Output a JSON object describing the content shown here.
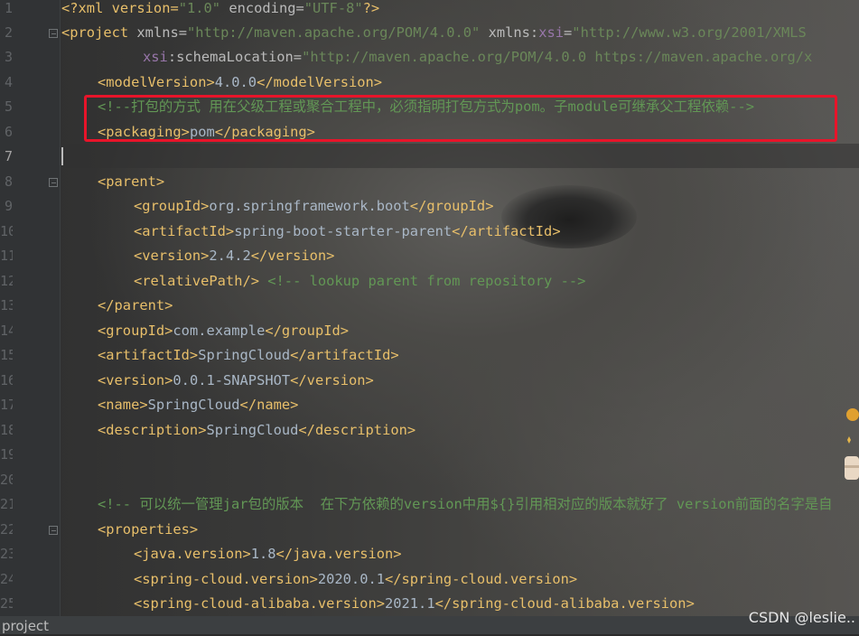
{
  "editor": {
    "line_numbers": [
      "1",
      "2",
      "3",
      "4",
      "5",
      "6",
      "7",
      "8",
      "9",
      "10",
      "11",
      "12",
      "13",
      "14",
      "15",
      "16",
      "17",
      "18",
      "19",
      "20",
      "21",
      "22",
      "23",
      "24",
      "25"
    ],
    "current_line": 7
  },
  "code": {
    "l1": {
      "a": "<?xml version=",
      "b": "\"1.0\"",
      "c": " encoding=",
      "d": "\"UTF-8\"",
      "e": "?>"
    },
    "l2": {
      "a": "<project ",
      "b": "xmlns=",
      "c": "\"http://maven.apache.org/POM/4.0.0\"",
      "d": " xmlns:",
      "e": "xsi",
      "f": "=",
      "g": "\"http://www.w3.org/2001/XMLS"
    },
    "l3": {
      "a": "xsi",
      "b": ":schemaLocation=",
      "c": "\"http://maven.apache.org/POM/4.0.0 https://maven.apache.org/x"
    },
    "l4": {
      "a": "<modelVersion>",
      "b": "4.0.0",
      "c": "</modelVersion>"
    },
    "l5": {
      "a": "<!--打包的方式 用在父级工程或聚合工程中，必须指明打包方式为pom。子module可继承父工程依赖-->"
    },
    "l6": {
      "a": "<packaging>",
      "b": "pom",
      "c": "</packaging>"
    },
    "l8": {
      "a": "<parent>"
    },
    "l9": {
      "a": "<groupId>",
      "b": "org.springframework.boot",
      "c": "</groupId>"
    },
    "l10": {
      "a": "<artifactId>",
      "b": "spring-boot-starter-parent",
      "c": "</artifactId>"
    },
    "l11": {
      "a": "<version>",
      "b": "2.4.2",
      "c": "</version>"
    },
    "l12": {
      "a": "<relativePath/>",
      "b": " <!-- lookup parent from repository -->"
    },
    "l13": {
      "a": "</parent>"
    },
    "l14": {
      "a": "<groupId>",
      "b": "com.example",
      "c": "</groupId>"
    },
    "l15": {
      "a": "<artifactId>",
      "b": "SpringCloud",
      "c": "</artifactId>"
    },
    "l16": {
      "a": "<version>",
      "b": "0.0.1-SNAPSHOT",
      "c": "</version>"
    },
    "l17": {
      "a": "<name>",
      "b": "SpringCloud",
      "c": "</name>"
    },
    "l18": {
      "a": "<description>",
      "b": "SpringCloud",
      "c": "</description>"
    },
    "l21": {
      "a": "<!-- 可以统一管理jar包的版本  在下方依赖的version中用${}引用相对应的版本就好了 version前面的名字是自"
    },
    "l22": {
      "a": "<properties>"
    },
    "l23": {
      "a": "<java.version>",
      "b": "1.8",
      "c": "</java.version>"
    },
    "l24": {
      "a": "<spring-cloud.version>",
      "b": "2020.0.1",
      "c": "</spring-cloud.version>"
    },
    "l25": {
      "a": "<spring-cloud-alibaba.version>",
      "b": "2021.1",
      "c": "</spring-cloud-alibaba.version>"
    }
  },
  "statusbar": {
    "text": "project"
  },
  "watermark": "CSDN @leslie..",
  "colors": {
    "highlight_box": "#e8142a",
    "tag": "#e8bf6a",
    "string": "#6a8759",
    "comment": "#629755",
    "namespace": "#9876aa"
  }
}
